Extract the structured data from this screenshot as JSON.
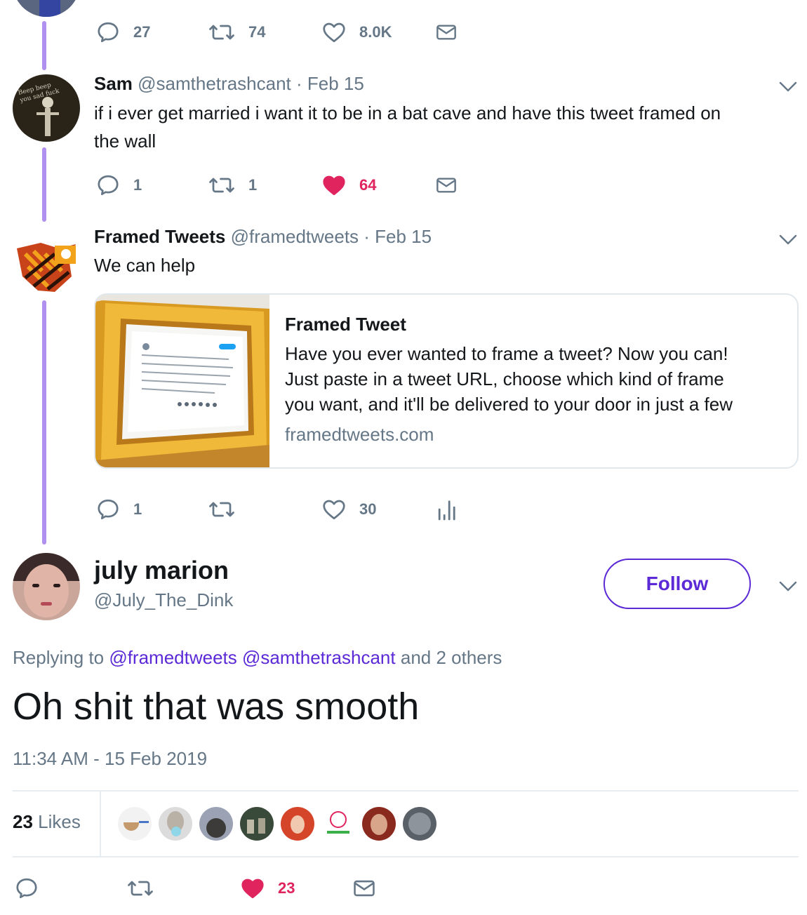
{
  "top_actions": {
    "reply_count": "27",
    "retweet_count": "74",
    "like_count": "8.0K"
  },
  "tweet_sam": {
    "name": "Sam",
    "handle_date": "@samthetrashcant · Feb 15",
    "text_line1": "if i ever get married i want it to be in a bat cave and have this tweet framed on",
    "text_line2": "the wall",
    "avatar_text": "Beep beep you sad fuck",
    "reply_count": "1",
    "retweet_count": "1",
    "like_count": "64"
  },
  "tweet_framed": {
    "name": "Framed Tweets",
    "handle_date": "@framedtweets · Feb 15",
    "text": "We can help",
    "card": {
      "title": "Framed Tweet",
      "desc_line1": "Have you ever wanted to frame a tweet? Now you can!",
      "desc_line2": "Just paste in a tweet URL, choose which kind of frame",
      "desc_line3": "you want, and it'll be delivered to your door in just a few",
      "url": "framedtweets.com"
    },
    "reply_count": "1",
    "retweet_count": "",
    "like_count": "30"
  },
  "main_tweet": {
    "name": "july marion",
    "handle": "@July_The_Dink",
    "follow_label": "Follow",
    "replying_prefix": "Replying to",
    "replying_user1": "@framedtweets",
    "replying_user2": "@samthetrashcant",
    "replying_suffix": "and 2 others",
    "text": "Oh shit that was smooth",
    "timestamp": "11:34 AM - 15 Feb 2019",
    "likes_count": "23",
    "likes_label": "Likes",
    "like_count": "23"
  },
  "colors": {
    "thread": "#b191f0",
    "accent": "#5b2ad6",
    "like": "#e0245e",
    "muted": "#657786"
  },
  "icons": [
    "reply-icon",
    "retweet-icon",
    "heart-icon",
    "mail-icon",
    "analytics-icon",
    "chevron-down-icon"
  ]
}
